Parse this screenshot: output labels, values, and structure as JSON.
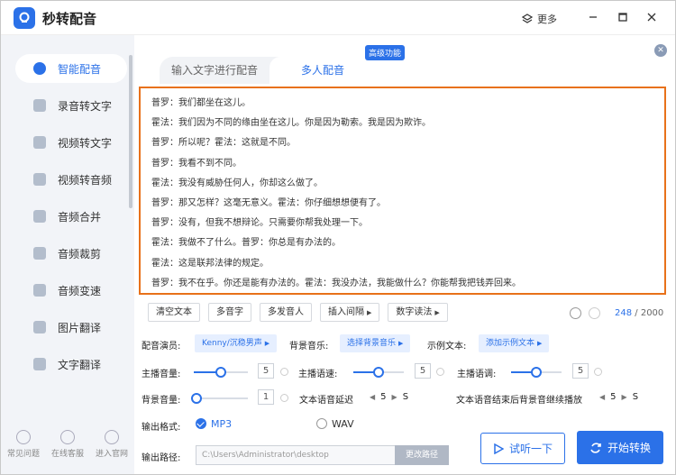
{
  "app": {
    "title": "秒转配音",
    "more_label": "更多"
  },
  "sidebar": {
    "items": [
      {
        "label": "智能配音",
        "active": true
      },
      {
        "label": "录音转文字"
      },
      {
        "label": "视频转文字"
      },
      {
        "label": "视频转音频"
      },
      {
        "label": "音频合并"
      },
      {
        "label": "音频裁剪"
      },
      {
        "label": "音频变速"
      },
      {
        "label": "图片翻译"
      },
      {
        "label": "文字翻译"
      }
    ],
    "bottom": [
      {
        "label": "常见问题"
      },
      {
        "label": "在线客服"
      },
      {
        "label": "进入官网"
      }
    ]
  },
  "tabs": [
    {
      "label": "输入文字进行配音"
    },
    {
      "label": "多人配音",
      "active": true
    }
  ],
  "badge": "高级功能",
  "script_lines": [
    "普罗：我们都坐在这儿。",
    "霍法：我们因为不同的缘由坐在这儿。你是因为勒索。我是因为欺诈。",
    "普罗：所以呢？霍法：这就是不同。",
    "普罗：我看不到不同。",
    "霍法：我没有威胁任何人，你却这么做了。",
    "普罗：那又怎样？这毫无意义。霍法：你仔细想想便有了。",
    "普罗：没有，但我不想辩论。只需要你帮我处理一下。",
    "霍法：我做不了什么。普罗：你总是有办法的。",
    "霍法：这是联邦法律的规定。",
    "普罗：我不在乎。你还是能有办法的。霍法：我没办法，我能做什么？你能帮我把钱弄回来。"
  ],
  "toolbar": [
    {
      "label": "清空文本"
    },
    {
      "label": "多音字"
    },
    {
      "label": "多发音人"
    },
    {
      "label": "插入间隔",
      "dropdown": true
    },
    {
      "label": "数字读法",
      "dropdown": true
    }
  ],
  "counter": {
    "current": "248",
    "max": "/ 2000"
  },
  "settings": {
    "voice_label": "配音演员:",
    "voice_value": "Kenny/沉稳男声",
    "bgm_label": "背景音乐:",
    "bgm_value": "选择背景音乐",
    "sample_label": "示例文本:",
    "sample_value": "添加示例文本",
    "volume_label": "主播音量:",
    "volume_value": "5",
    "volume_level": 0.5,
    "speed_label": "主播语速:",
    "speed_value": "5",
    "speed_level": 0.5,
    "pitch_label": "主播语调:",
    "pitch_value": "5",
    "pitch_level": 0.5,
    "bg_volume_label": "背景音量:",
    "bg_volume_value": "1",
    "bg_volume_level": 0.05,
    "delay_label": "文本语音延迟",
    "delay_value": "5",
    "delay_unit": "S",
    "continue_label": "文本语音结束后背景音继续播放",
    "continue_value": "5",
    "continue_unit": "S"
  },
  "output": {
    "format_label": "输出格式:",
    "formats": [
      {
        "label": "MP3",
        "selected": true
      },
      {
        "label": "WAV"
      }
    ],
    "path_label": "输出路径:",
    "path_value": "C:\\Users\\Administrator\\desktop",
    "change_path_label": "更改路径"
  },
  "actions": {
    "listen_label": "试听一下",
    "start_label": "开始转换"
  },
  "colors": {
    "accent": "#2b71e8",
    "editor_border": "#e8711a"
  }
}
